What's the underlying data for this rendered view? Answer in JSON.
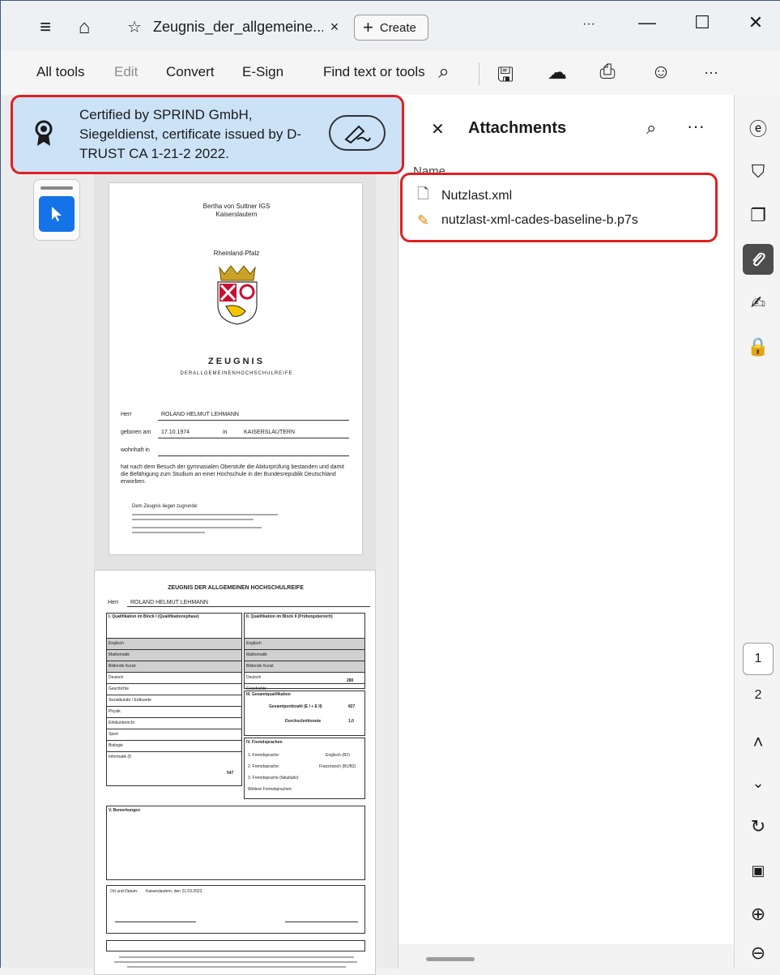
{
  "titlebar": {
    "tab_title": "Zeugnis_der_allgemeine...",
    "tab_close": "×",
    "new_tab_label": "Create",
    "more": "···"
  },
  "toolbar": {
    "all_tools": "All tools",
    "edit": "Edit",
    "convert": "Convert",
    "esign": "E-Sign",
    "find": "Find text or tools",
    "more": "···"
  },
  "certificate": {
    "text": "Certified by SPRIND GmbH, Siegeldienst, certificate issued by D-TRUST CA 1-21-2 2022."
  },
  "document": {
    "page1": {
      "school": "Bertha von Suttner IGS",
      "city": "Kaiserslautern",
      "state": "Rheinland-Pfalz",
      "heading": "ZEUGNIS",
      "subheading": "DERALLGEMEINENHOCHSCHULREIFE",
      "herr_label": "Herr",
      "name": "ROLAND HELMUT LEHMANN",
      "born_label": "geboren am",
      "born_date": "17.10.1974",
      "in_label": "in",
      "birthplace": "KAISERSLAUTERN",
      "residence_label": "wohnhaft in",
      "statement": "hat nach dem Besuch der gymnasialen Oberstufe die Abiturprüfung bestanden und damit die Befähigung zum Studium an einer Hochschule in der Bundesrepublik Deutschland erworben.",
      "basis": "Dem Zeugnis liegen zugrunde:"
    },
    "page2": {
      "heading": "ZEUGNIS DER ALLGEMEINEN HOCHSCHULREIFE",
      "herr_label": "Herr",
      "name": "ROLAND HELMUT LEHMANN",
      "block1_title": "I. Qualifikation im Block I (Qualifikationsphase)",
      "block2_title": "II. Qualifikation im Block II (Prüfungsbereich)",
      "subjects": [
        "Englisch",
        "Mathematik",
        "Bildende Kunst",
        "Deutsch",
        "Geschichte",
        "Sozialkunde / Erdkunde",
        "Physik",
        "Ethikunterricht",
        "Sport",
        "Biologie",
        "Informatik (f)"
      ],
      "exam_subjects": [
        "Englisch",
        "Mathematik",
        "Bildende Kunst",
        "Deutsch",
        "Geschichte"
      ],
      "gesamt_title": "III. Gesamtqualifikation",
      "gesamtpunktzahl_label": "Gesamtpunktzahl (E I + E II)",
      "gesamtpunktzahl": "827",
      "durchschnitt_label": "Durchschnittsnote",
      "durchschnitt": "1,0",
      "block2_total": "280",
      "block1_total": "547",
      "fremd_title": "IV. Fremdsprachen",
      "fremd1_label": "1. Fremdsprache:",
      "fremd1": "Englisch (B2)",
      "fremd2_label": "2. Fremdsprache:",
      "fremd2": "Französisch (B1/B2)",
      "fremd3_label": "3. Fremdsprache (fakultativ):",
      "fremd_weitere": "Weitere Fremdsprachen:",
      "bemerkungen": "V. Bemerkungen",
      "ort_label": "Ort und Datum:",
      "ort": "Kaiserslautern, den 21.03.2023"
    }
  },
  "attachments": {
    "title": "Attachments",
    "column": "Name",
    "files": [
      "Nutzlast.xml",
      "nutzlast-xml-cades-baseline-b.p7s"
    ]
  },
  "rail": {
    "current_page": "1",
    "next_page": "2"
  }
}
